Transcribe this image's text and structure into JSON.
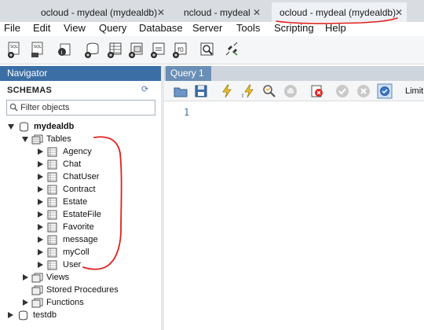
{
  "tabs": [
    {
      "label": "ocloud - mydeal (mydealdb)",
      "close": "✕"
    },
    {
      "label": "ncloud - mydeal",
      "close": "✕"
    },
    {
      "label": "ocloud - mydeal (mydealdb)",
      "close": "✕"
    }
  ],
  "menu": [
    "File",
    "Edit",
    "View",
    "Query",
    "Database",
    "Server",
    "Tools",
    "Scripting",
    "Help"
  ],
  "navigator": {
    "title": "Navigator",
    "schemas_label": "SCHEMAS",
    "filter_placeholder": "Filter objects",
    "schema": "mydealdb",
    "tables_label": "Tables",
    "tables": [
      "Agency",
      "Chat",
      "ChatUser",
      "Contract",
      "Estate",
      "EstateFile",
      "Favorite",
      "message",
      "myColl",
      "User"
    ],
    "views_label": "Views",
    "stored_procedures_label": "Stored Procedures",
    "functions_label": "Functions",
    "other_schema": "testdb"
  },
  "editor": {
    "tab_label": "Query 1",
    "line_number": "1",
    "limit_label": "Limit"
  },
  "colors": {
    "accent": "#3a6ea5",
    "annotation": "#e0201c"
  }
}
